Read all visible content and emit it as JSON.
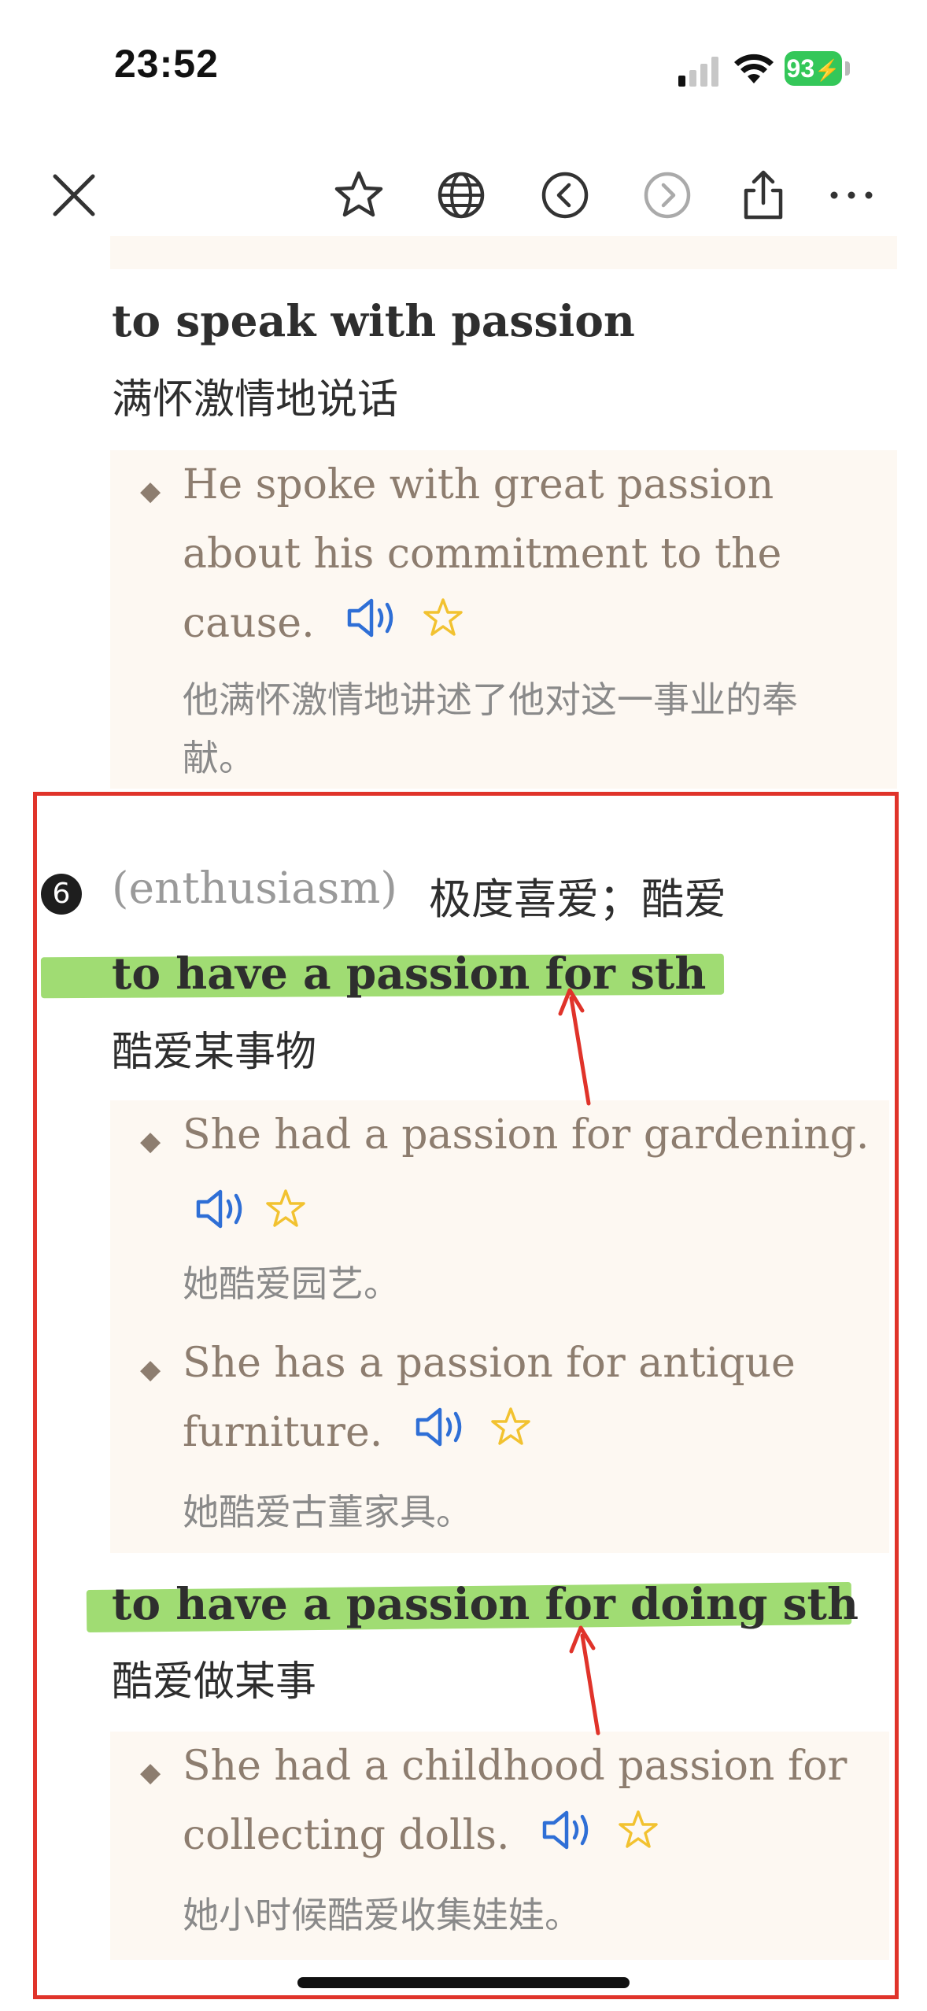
{
  "status_bar": {
    "time": "23:52",
    "battery": "93"
  },
  "toolbar": {
    "icons": [
      "close-icon",
      "star-icon",
      "globe-icon",
      "back-circle-icon",
      "forward-circle-icon",
      "share-icon",
      "more-icon"
    ]
  },
  "top_entry": {
    "phrase": "to speak with passion",
    "translation": "满怀激情地说话",
    "example": {
      "en_line1": "He spoke with great passion",
      "en_line2": "about his commitment to the",
      "en_line3": "cause.",
      "cn_line1": "他满怀激情地讲述了他对这一事业的奉",
      "cn_line2": "献。"
    }
  },
  "sense": {
    "number": "6",
    "label": "(enthusiasm)",
    "definition": "极度喜爱；酷爱",
    "phrases": [
      {
        "phrase": "to have a passion for sth",
        "translation": "酷爱某事物",
        "examples": [
          {
            "en_line1": "She had a passion for gardening.",
            "en_line2": "",
            "cn": "她酷爱园艺。"
          },
          {
            "en_line1": "She has a passion for antique",
            "en_line2": "furniture.",
            "cn": "她酷爱古董家具。"
          }
        ]
      },
      {
        "phrase": "to have a passion for doing sth",
        "translation": "酷爱做某事",
        "examples": [
          {
            "en_line1": "She had a childhood passion for",
            "en_line2": "collecting dolls.",
            "cn": "她小时候酷爱收集娃娃。"
          }
        ]
      }
    ]
  },
  "colors": {
    "highlight": "#8fd65a",
    "annotation_red": "#e0332a",
    "speaker_blue": "#2f6fd6",
    "star_yellow": "#f2c230",
    "example_bg": "#fdf8f2",
    "example_text": "#8d7d6f"
  }
}
